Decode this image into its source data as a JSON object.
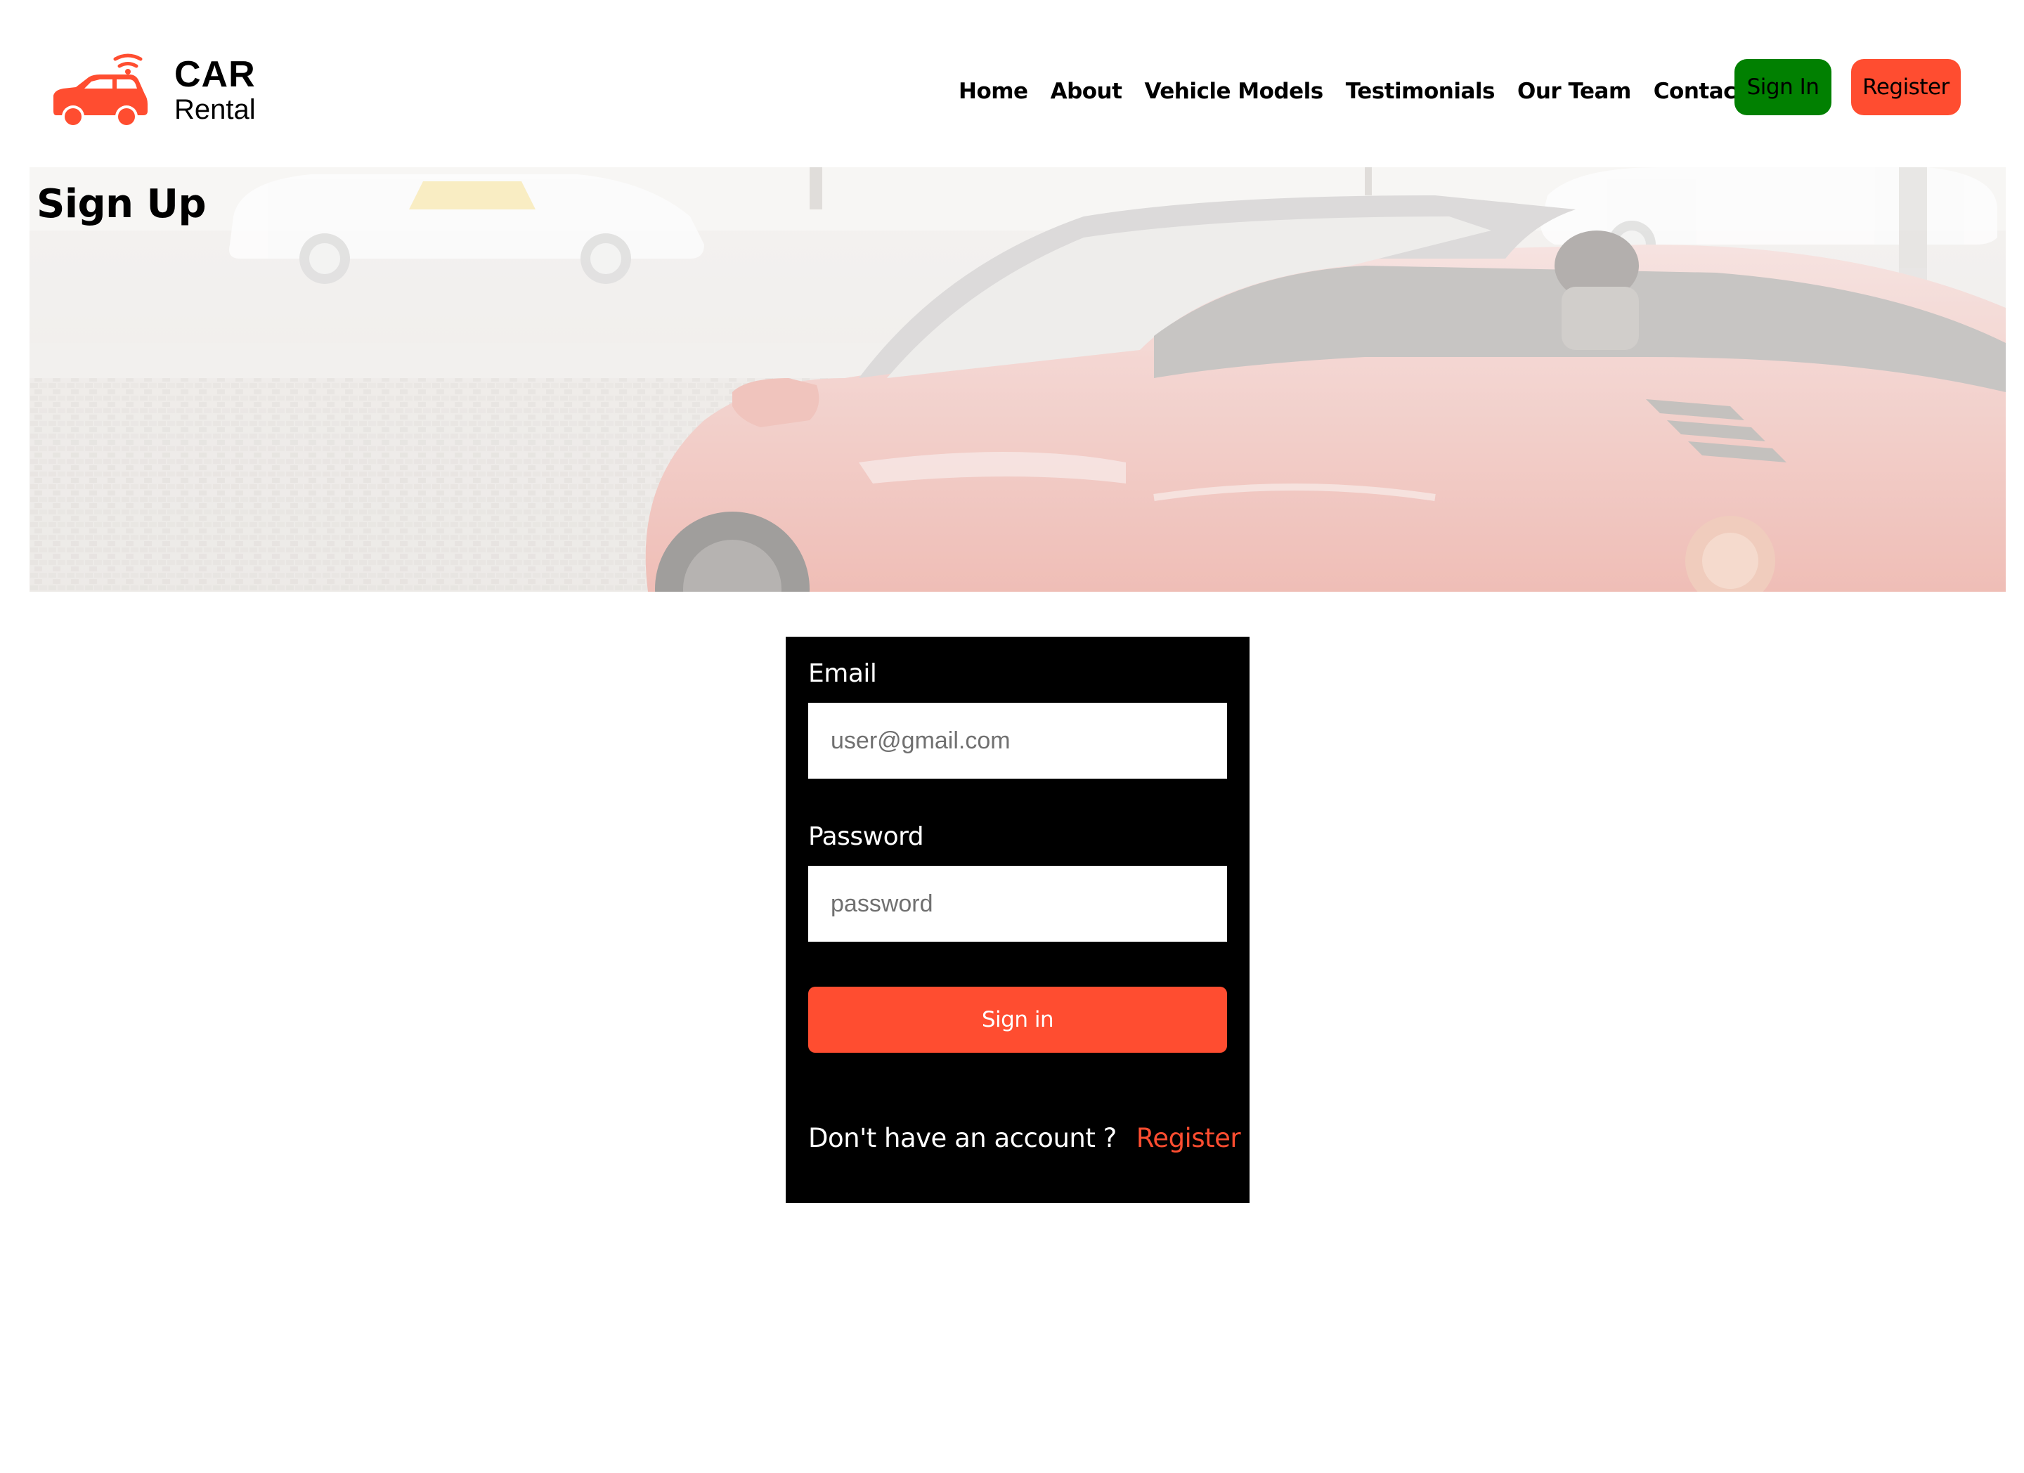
{
  "brand": {
    "title": "CAR",
    "subtitle": "Rental",
    "accent": "#ff4d30"
  },
  "nav": {
    "items": [
      {
        "label": "Home"
      },
      {
        "label": "About"
      },
      {
        "label": "Vehicle Models"
      },
      {
        "label": "Testimonials"
      },
      {
        "label": "Our Team"
      },
      {
        "label": "Contact"
      }
    ],
    "sign_in_label": "Sign In",
    "register_label": "Register",
    "sign_in_color": "#018001",
    "register_color": "#ff4d30"
  },
  "hero": {
    "title": "Sign Up"
  },
  "form": {
    "email_label": "Email",
    "email_placeholder": "user@gmail.com",
    "password_label": "Password",
    "password_placeholder": "password",
    "submit_label": "Sign in",
    "no_account_text": "Don't have an account ?",
    "register_link_label": "Register"
  }
}
